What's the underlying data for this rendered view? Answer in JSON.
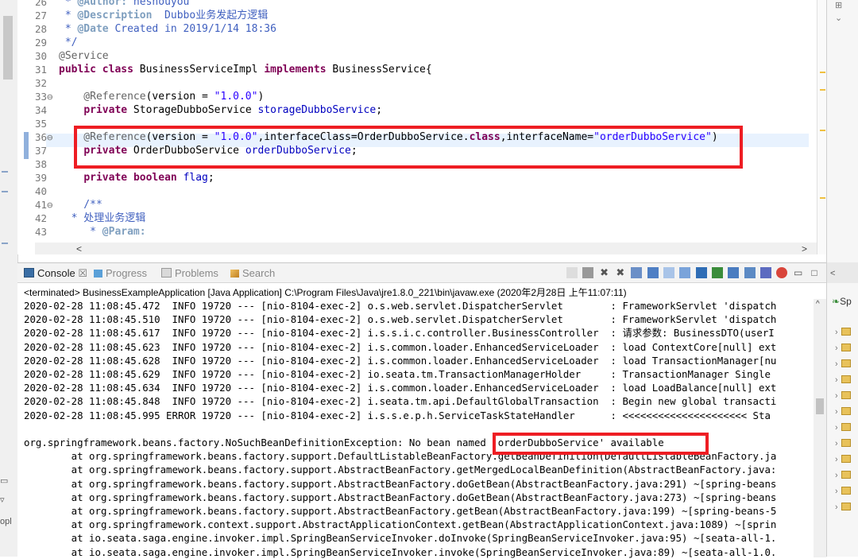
{
  "editor": {
    "lines": [
      {
        "n": "26",
        "parts": [
          {
            "t": " * ",
            "c": "cm"
          },
          {
            "t": "@Author:",
            "c": "cmtag"
          },
          {
            "t": " heshouyou",
            "c": "cm"
          }
        ]
      },
      {
        "n": "27",
        "parts": [
          {
            "t": " * ",
            "c": "cm"
          },
          {
            "t": "@Description",
            "c": "cmtag"
          },
          {
            "t": "  Dubbo业务发起方逻辑",
            "c": "cm"
          }
        ]
      },
      {
        "n": "28",
        "parts": [
          {
            "t": " * ",
            "c": "cm"
          },
          {
            "t": "@Date",
            "c": "cmtag"
          },
          {
            "t": " Created in 2019/1/14 18:36",
            "c": "cm"
          }
        ]
      },
      {
        "n": "29",
        "parts": [
          {
            "t": " */",
            "c": "cm"
          }
        ]
      },
      {
        "n": "30",
        "parts": [
          {
            "t": "@Service",
            "c": "ann"
          }
        ]
      },
      {
        "n": "31",
        "parts": [
          {
            "t": "public",
            "c": "kw"
          },
          {
            "t": " ",
            "c": ""
          },
          {
            "t": "class",
            "c": "kw"
          },
          {
            "t": " BusinessServiceImpl ",
            "c": ""
          },
          {
            "t": "implements",
            "c": "kw"
          },
          {
            "t": " BusinessService{",
            "c": ""
          }
        ]
      },
      {
        "n": "32",
        "parts": []
      },
      {
        "n": "33⊖",
        "parts": [
          {
            "t": "    @Reference",
            "c": "ann"
          },
          {
            "t": "(version = ",
            "c": ""
          },
          {
            "t": "\"1.0.0\"",
            "c": "str"
          },
          {
            "t": ")",
            "c": ""
          }
        ]
      },
      {
        "n": "34",
        "parts": [
          {
            "t": "    ",
            "c": ""
          },
          {
            "t": "private",
            "c": "kw"
          },
          {
            "t": " StorageDubboService ",
            "c": ""
          },
          {
            "t": "storageDubboService",
            "c": "fld"
          },
          {
            "t": ";",
            "c": ""
          }
        ]
      },
      {
        "n": "35",
        "parts": []
      },
      {
        "n": "36⊖",
        "parts": [
          {
            "t": "    @Reference",
            "c": "ann"
          },
          {
            "t": "(version = ",
            "c": ""
          },
          {
            "t": "\"1.0.0\"",
            "c": "str"
          },
          {
            "t": ",interfaceClass=OrderDubboService.",
            "c": ""
          },
          {
            "t": "class",
            "c": "kw"
          },
          {
            "t": ",interfaceName=",
            "c": ""
          },
          {
            "t": "\"orderDubboService\"",
            "c": "str"
          },
          {
            "t": ")",
            "c": ""
          }
        ]
      },
      {
        "n": "37",
        "parts": [
          {
            "t": "    ",
            "c": ""
          },
          {
            "t": "private",
            "c": "kw"
          },
          {
            "t": " OrderDubboService ",
            "c": ""
          },
          {
            "t": "orderDubboService",
            "c": "fld"
          },
          {
            "t": ";",
            "c": ""
          }
        ]
      },
      {
        "n": "38",
        "parts": []
      },
      {
        "n": "39",
        "parts": [
          {
            "t": "    ",
            "c": ""
          },
          {
            "t": "private",
            "c": "kw"
          },
          {
            "t": " ",
            "c": ""
          },
          {
            "t": "boolean",
            "c": "kw"
          },
          {
            "t": " ",
            "c": ""
          },
          {
            "t": "flag",
            "c": "fld"
          },
          {
            "t": ";",
            "c": ""
          }
        ]
      },
      {
        "n": "40",
        "parts": []
      },
      {
        "n": "41⊖",
        "parts": [
          {
            "t": "    /**",
            "c": "cm"
          }
        ]
      },
      {
        "n": "42",
        "parts": [
          {
            "t": "  * 处理业务逻辑",
            "c": "cm"
          }
        ]
      },
      {
        "n": "43",
        "parts": [
          {
            "t": "     * ",
            "c": "cm"
          },
          {
            "t": "@Param:",
            "c": "cmtag"
          }
        ]
      }
    ]
  },
  "console": {
    "tabs": [
      {
        "label": "Console",
        "suffix": " ☒"
      },
      {
        "label": "Progress",
        "suffix": ""
      },
      {
        "label": "Problems",
        "suffix": ""
      },
      {
        "label": "Search",
        "suffix": ""
      }
    ],
    "terminated": "<terminated> BusinessExampleApplication [Java Application] C:\\Program Files\\Java\\jre1.8.0_221\\bin\\javaw.exe (2020年2月28日 上午11:07:11)",
    "log": [
      "2020-02-28 11:08:45.472  INFO 19720 --- [nio-8104-exec-2] o.s.web.servlet.DispatcherServlet        : FrameworkServlet 'dispatch",
      "2020-02-28 11:08:45.510  INFO 19720 --- [nio-8104-exec-2] o.s.web.servlet.DispatcherServlet        : FrameworkServlet 'dispatch",
      "2020-02-28 11:08:45.617  INFO 19720 --- [nio-8104-exec-2] i.s.s.i.c.controller.BusinessController  : 请求参数: BusinessDTO(userI",
      "2020-02-28 11:08:45.623  INFO 19720 --- [nio-8104-exec-2] i.s.common.loader.EnhancedServiceLoader  : load ContextCore[null] ext",
      "2020-02-28 11:08:45.628  INFO 19720 --- [nio-8104-exec-2] i.s.common.loader.EnhancedServiceLoader  : load TransactionManager[nu",
      "2020-02-28 11:08:45.629  INFO 19720 --- [nio-8104-exec-2] io.seata.tm.TransactionManagerHolder     : TransactionManager Single",
      "2020-02-28 11:08:45.634  INFO 19720 --- [nio-8104-exec-2] i.s.common.loader.EnhancedServiceLoader  : load LoadBalance[null] ext",
      "2020-02-28 11:08:45.848  INFO 19720 --- [nio-8104-exec-2] i.seata.tm.api.DefaultGlobalTransaction  : Begin new global transacti",
      "2020-02-28 11:08:45.995 ERROR 19720 --- [nio-8104-exec-2] i.s.s.e.p.h.ServiceTaskStateHandler      : <<<<<<<<<<<<<<<<<<<<< Sta",
      "",
      "org.springframework.beans.factory.NoSuchBeanDefinitionException: No bean named 'orderDubboService' available",
      "        at org.springframework.beans.factory.support.DefaultListableBeanFactory.getBeanDefinition(DefaultListableBeanFactory.ja",
      "        at org.springframework.beans.factory.support.AbstractBeanFactory.getMergedLocalBeanDefinition(AbstractBeanFactory.java:",
      "        at org.springframework.beans.factory.support.AbstractBeanFactory.doGetBean(AbstractBeanFactory.java:291) ~[spring-beans",
      "        at org.springframework.beans.factory.support.AbstractBeanFactory.doGetBean(AbstractBeanFactory.java:273) ~[spring-beans",
      "        at org.springframework.beans.factory.support.AbstractBeanFactory.getBean(AbstractBeanFactory.java:199) ~[spring-beans-5",
      "        at org.springframework.context.support.AbstractApplicationContext.getBean(AbstractApplicationContext.java:1089) ~[sprin",
      "        at io.seata.saga.engine.invoker.impl.SpringBeanServiceInvoker.doInvoke(SpringBeanServiceInvoker.java:95) ~[seata-all-1.",
      "        at io.seata.saga.engine.invoker.impl.SpringBeanServiceInvoker.invoke(SpringBeanServiceInvoker.java:89) ~[seata-all-1.0."
    ]
  },
  "right_panel": {
    "label": "Sp"
  },
  "left_strip": {
    "label": "opl"
  },
  "colors": {
    "highlight_box": "#ee1d23",
    "keyword": "#7f0055",
    "string": "#2a00ff",
    "comment": "#3f5fbf",
    "field": "#0000c0"
  }
}
